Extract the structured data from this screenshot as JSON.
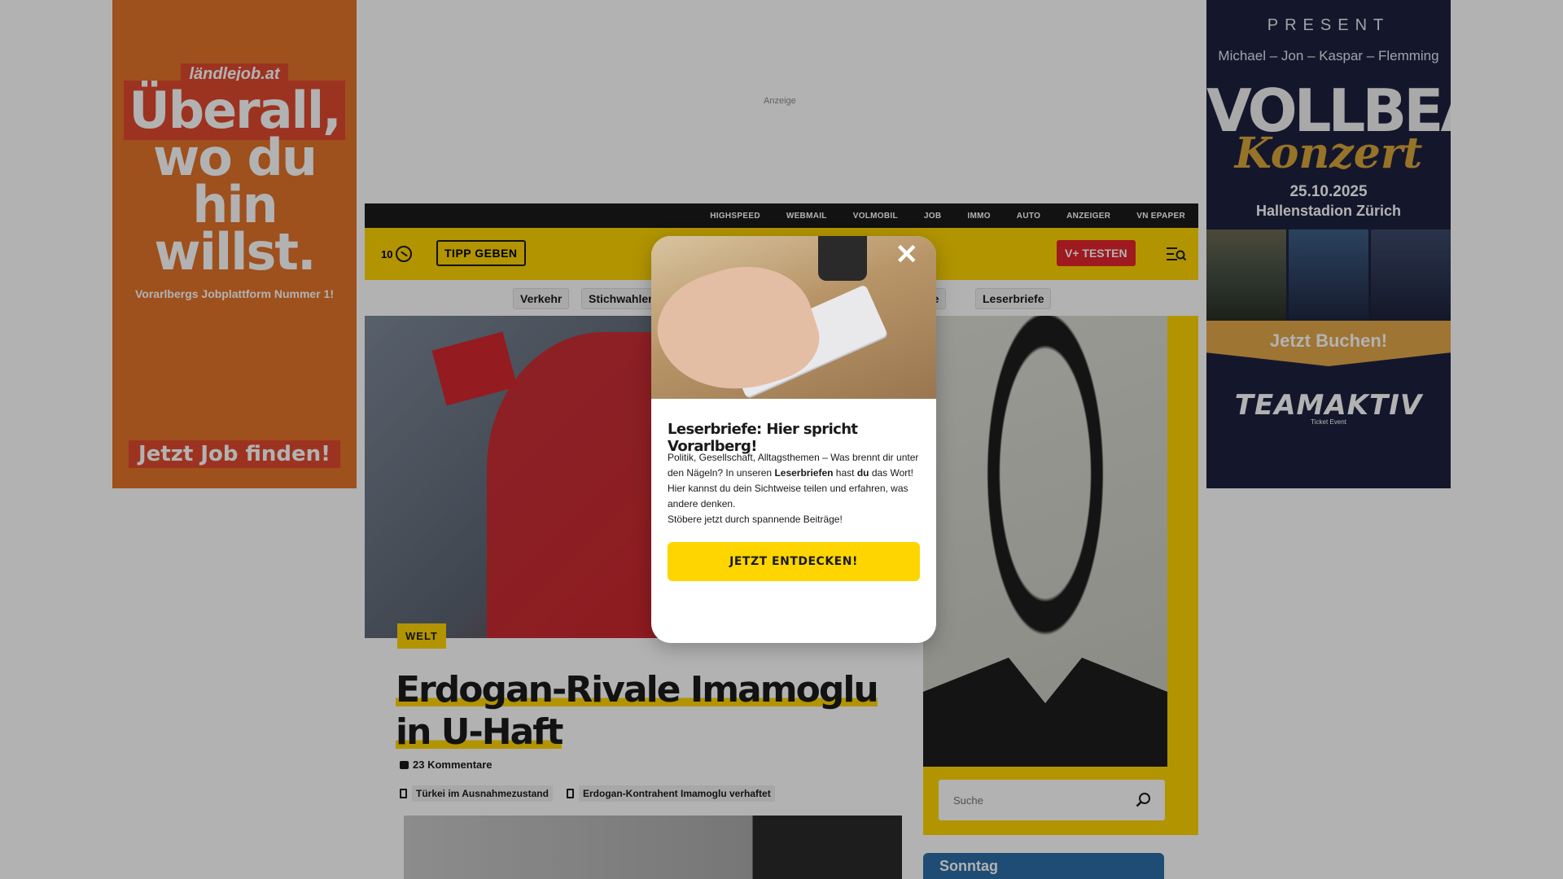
{
  "ads": {
    "anzeige_label": "Anzeige",
    "left": {
      "brand": "ländlejob.at",
      "headline_line1": "Überall,",
      "headline_line2": "wo du hin",
      "headline_line3": "willst.",
      "subline": "Vorarlbergs Jobplattform Nummer 1!",
      "cta": "Jetzt Job finden!"
    },
    "right": {
      "present": "PRESENT",
      "names": "Michael – Jon – Kaspar – Flemming",
      "band": "VOLLBEAT",
      "event": "Konzert",
      "date": "25.10.2025",
      "venue": "Hallenstadion Zürich",
      "cta": "Jetzt Buchen!",
      "organizer": "TEAMAKTIV",
      "organizer_sub": "Ticket Event"
    }
  },
  "topbar": {
    "links": [
      "HIGHSPEED",
      "WEBMAIL",
      "VOLMOBIL",
      "JOB",
      "IMMO",
      "AUTO",
      "ANZEIGER",
      "VN EPAPER"
    ]
  },
  "navbar": {
    "count": "10",
    "tipp_label": "TIPP GEBEN",
    "vplus_label": "V+ TESTEN"
  },
  "chips": [
    "Verkehr",
    "Stichwahlen",
    "rufe",
    "Leserbriefe"
  ],
  "article": {
    "category": "WELT",
    "headline": "Erdogan-Rivale Imamoglu in U-Haft",
    "comments": "23 Kommentare",
    "related": [
      "Türkei im Ausnahmezustand",
      "Erdogan-Kontrahent Imamoglu verhaftet"
    ]
  },
  "sidebar": {
    "search_placeholder": "Suche",
    "teaser_label": "Sonntag"
  },
  "modal": {
    "title": "Leserbriefe: Hier spricht Vorarlberg!",
    "body_part1": "Politik, Gesellschaft, Alltagsthemen – Was brennt dir unter den Nägeln? In unseren ",
    "body_bold1": "Leserbriefen",
    "body_part2": " hast ",
    "body_bold2": "du",
    "body_part3": " das Wort! Hier kannst du dein Sichtweise teilen und erfahren, was andere denken.",
    "body_part4": "Stöbere jetzt durch spannende Beiträge!",
    "cta": "JETZT ENTDECKEN!",
    "close_glyph": "✕"
  },
  "colors": {
    "brand_yellow": "#ffd500",
    "vplus_red": "#e3262e",
    "topbar_black": "#1a1a1a"
  }
}
